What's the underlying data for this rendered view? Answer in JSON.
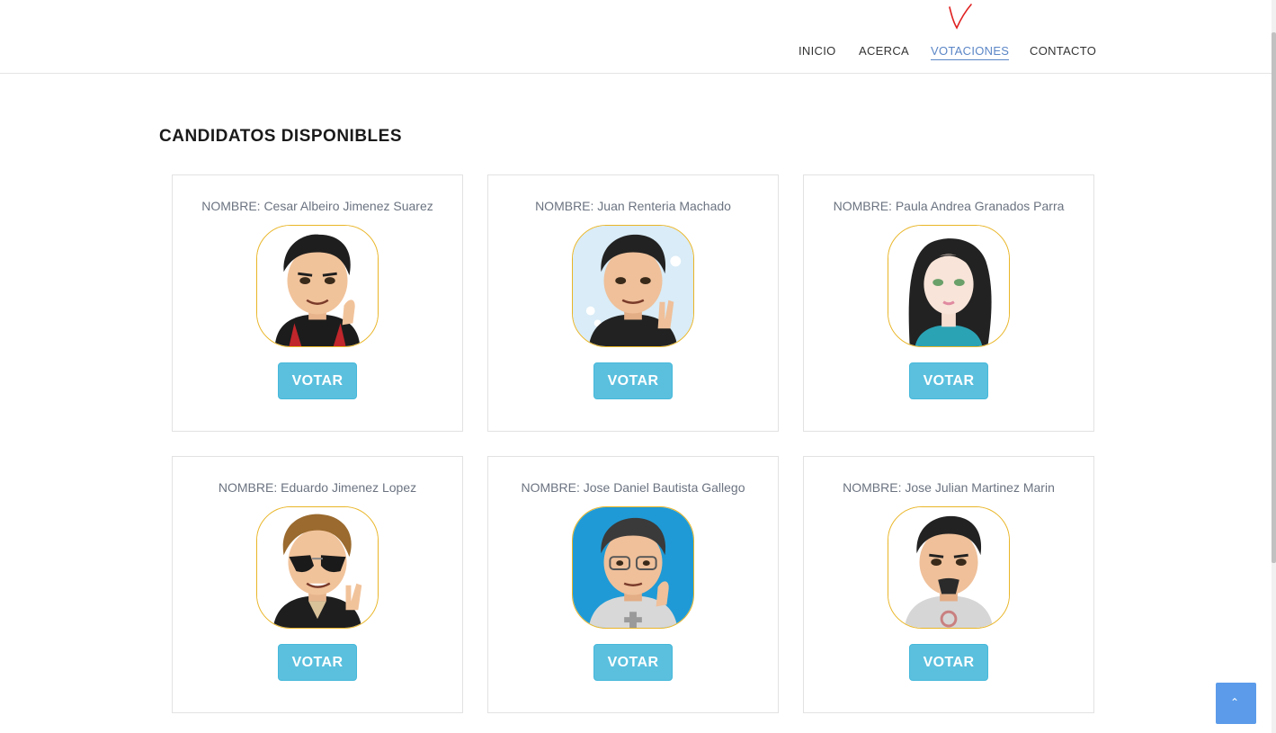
{
  "nav": {
    "items": [
      {
        "label": "INICIO"
      },
      {
        "label": "ACERCA"
      },
      {
        "label": "VOTACIONES"
      },
      {
        "label": "CONTACTO"
      }
    ]
  },
  "section_title": "CANDIDATOS DISPONIBLES",
  "candidates": [
    {
      "name": "NOMBRE: Cesar Albeiro Jimenez Suarez",
      "button": "VOTAR",
      "icon": "avatar-icon"
    },
    {
      "name": "NOMBRE: Juan Renteria Machado",
      "button": "VOTAR",
      "icon": "avatar-icon"
    },
    {
      "name": "NOMBRE: Paula Andrea Granados Parra",
      "button": "VOTAR",
      "icon": "avatar-icon"
    },
    {
      "name": "NOMBRE: Eduardo Jimenez Lopez",
      "button": "VOTAR",
      "icon": "avatar-icon"
    },
    {
      "name": "NOMBRE: Jose Daniel Bautista Gallego",
      "button": "VOTAR",
      "icon": "avatar-icon"
    },
    {
      "name": "NOMBRE: Jose Julian Martinez Marin",
      "button": "VOTAR",
      "icon": "avatar-icon"
    }
  ],
  "colors": {
    "button": "#5bc0de",
    "nav_active": "#5b86c6",
    "avatar_border": "#e9b526",
    "back_to_top": "#5b9bea"
  },
  "back_to_top_icon": "chevron-up-icon"
}
